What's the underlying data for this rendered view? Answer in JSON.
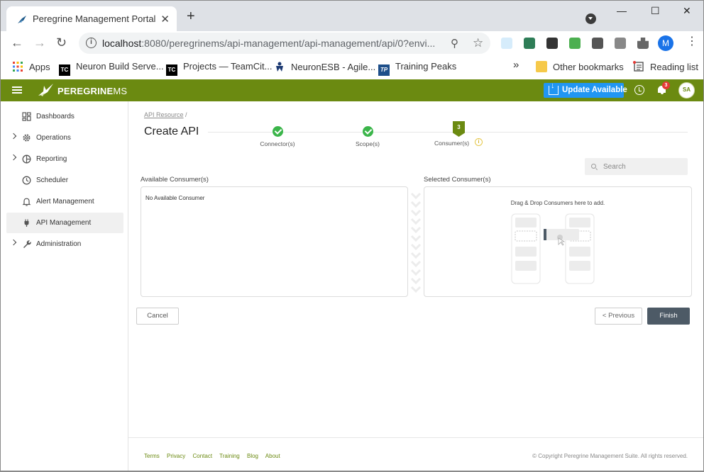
{
  "browser": {
    "tab_title": "Peregrine Management Portal",
    "new_tab": "+",
    "window_controls": {
      "minimize": "—",
      "maximize": "☐",
      "close": "✕"
    },
    "url_host": "localhost",
    "url_rest": ":8080/peregrinems/api-management/api-management/api/0?envi...",
    "profile_initial": "M",
    "bookmarks": [
      {
        "label": "Apps",
        "icon": "apps-grid-icon"
      },
      {
        "label": "Neuron Build Serve...",
        "icon": "teamcity-icon"
      },
      {
        "label": "Projects — TeamCit...",
        "icon": "teamcity-icon"
      },
      {
        "label": "NeuronESB - Agile...",
        "icon": "jira-icon"
      },
      {
        "label": "Training Peaks",
        "icon": "trainingpeaks-icon"
      }
    ],
    "bookmarks_overflow": "»",
    "other_bookmarks": "Other bookmarks",
    "reading_list": "Reading list"
  },
  "app": {
    "brand_bold": "PEREGRINE",
    "brand_thin": "MS",
    "update_label": "Update Available",
    "notification_count": "3",
    "avatar_initials": "SA",
    "brand_color": "#6b8a11"
  },
  "sidebar": {
    "items": [
      {
        "label": "Dashboards",
        "icon": "dashboard-icon",
        "expandable": false,
        "active": false
      },
      {
        "label": "Operations",
        "icon": "gear-icon",
        "expandable": true,
        "active": false
      },
      {
        "label": "Reporting",
        "icon": "pie-chart-icon",
        "expandable": true,
        "active": false
      },
      {
        "label": "Scheduler",
        "icon": "clock-icon",
        "expandable": false,
        "active": false
      },
      {
        "label": "Alert Management",
        "icon": "bell-icon",
        "expandable": false,
        "active": false
      },
      {
        "label": "API Management",
        "icon": "plug-icon",
        "expandable": false,
        "active": true
      },
      {
        "label": "Administration",
        "icon": "wrench-icon",
        "expandable": true,
        "active": false
      }
    ]
  },
  "main": {
    "breadcrumb_link": "API Resource",
    "breadcrumb_sep": "/",
    "title": "Create API",
    "steps": [
      {
        "label": "Connector(s)",
        "state": "done"
      },
      {
        "label": "Scope(s)",
        "state": "done"
      },
      {
        "label": "Consumer(s)",
        "state": "current",
        "number": "3"
      }
    ],
    "search_placeholder": "Search",
    "available_title": "Available Consumer(s)",
    "available_empty": "No Available Consumer",
    "selected_title": "Selected Consumer(s)",
    "selected_hint": "Drag & Drop Consumers here to add.",
    "cancel_label": "Cancel",
    "previous_label": "< Previous",
    "finish_label": "Finish"
  },
  "footer": {
    "links": [
      "Terms",
      "Privacy",
      "Contact",
      "Training",
      "Blog",
      "About"
    ],
    "copyright": "© Copyright Peregrine Management Suite. All rights reserved."
  }
}
